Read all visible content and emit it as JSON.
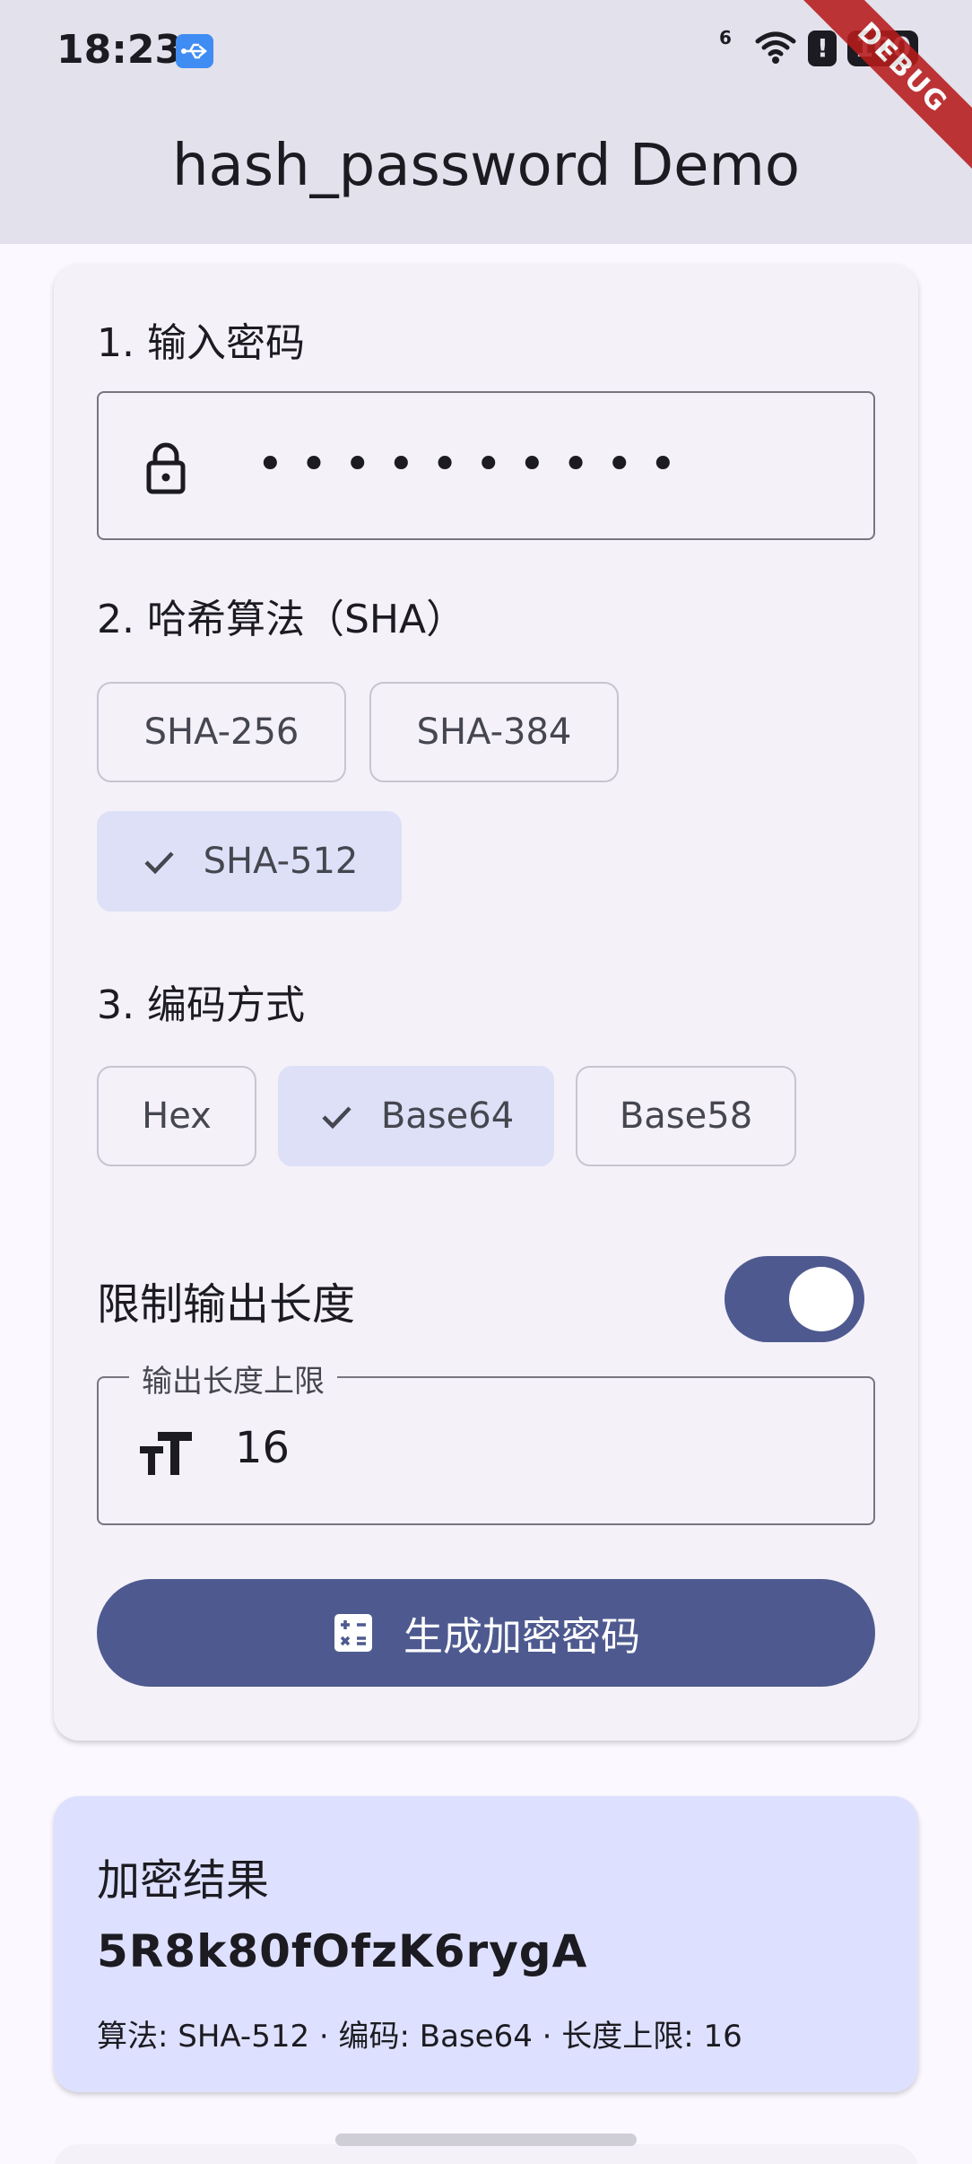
{
  "status_bar": {
    "time": "18:23",
    "network": "6",
    "alert": "!",
    "battery": "100"
  },
  "app_bar": {
    "title": "hash_password Demo",
    "debug_banner": "DEBUG"
  },
  "form": {
    "step1_label": "1. 输入密码",
    "password_masked": "••••••••••",
    "step2_label": "2. 哈希算法（SHA）",
    "algorithms": [
      {
        "label": "SHA-256",
        "selected": false
      },
      {
        "label": "SHA-384",
        "selected": false
      },
      {
        "label": "SHA-512",
        "selected": true
      }
    ],
    "step3_label": "3. 编码方式",
    "encodings": [
      {
        "label": "Hex",
        "selected": false
      },
      {
        "label": "Base64",
        "selected": true
      },
      {
        "label": "Base58",
        "selected": false
      }
    ],
    "limit_switch_label": "限制输出长度",
    "limit_enabled": true,
    "length_field_label": "输出长度上限",
    "length_value": "16",
    "generate_button_label": "生成加密密码"
  },
  "result": {
    "title": "加密结果",
    "value": "5R8k80fOfzK6rygA",
    "meta": "算法: SHA-512 · 编码: Base64 · 长度上限: 16"
  },
  "colors": {
    "primary": "#4e5a8f",
    "chip_selected": "#dee0f7",
    "result_bg": "#dee0ff",
    "app_bar_bg": "#e3e1ec"
  }
}
